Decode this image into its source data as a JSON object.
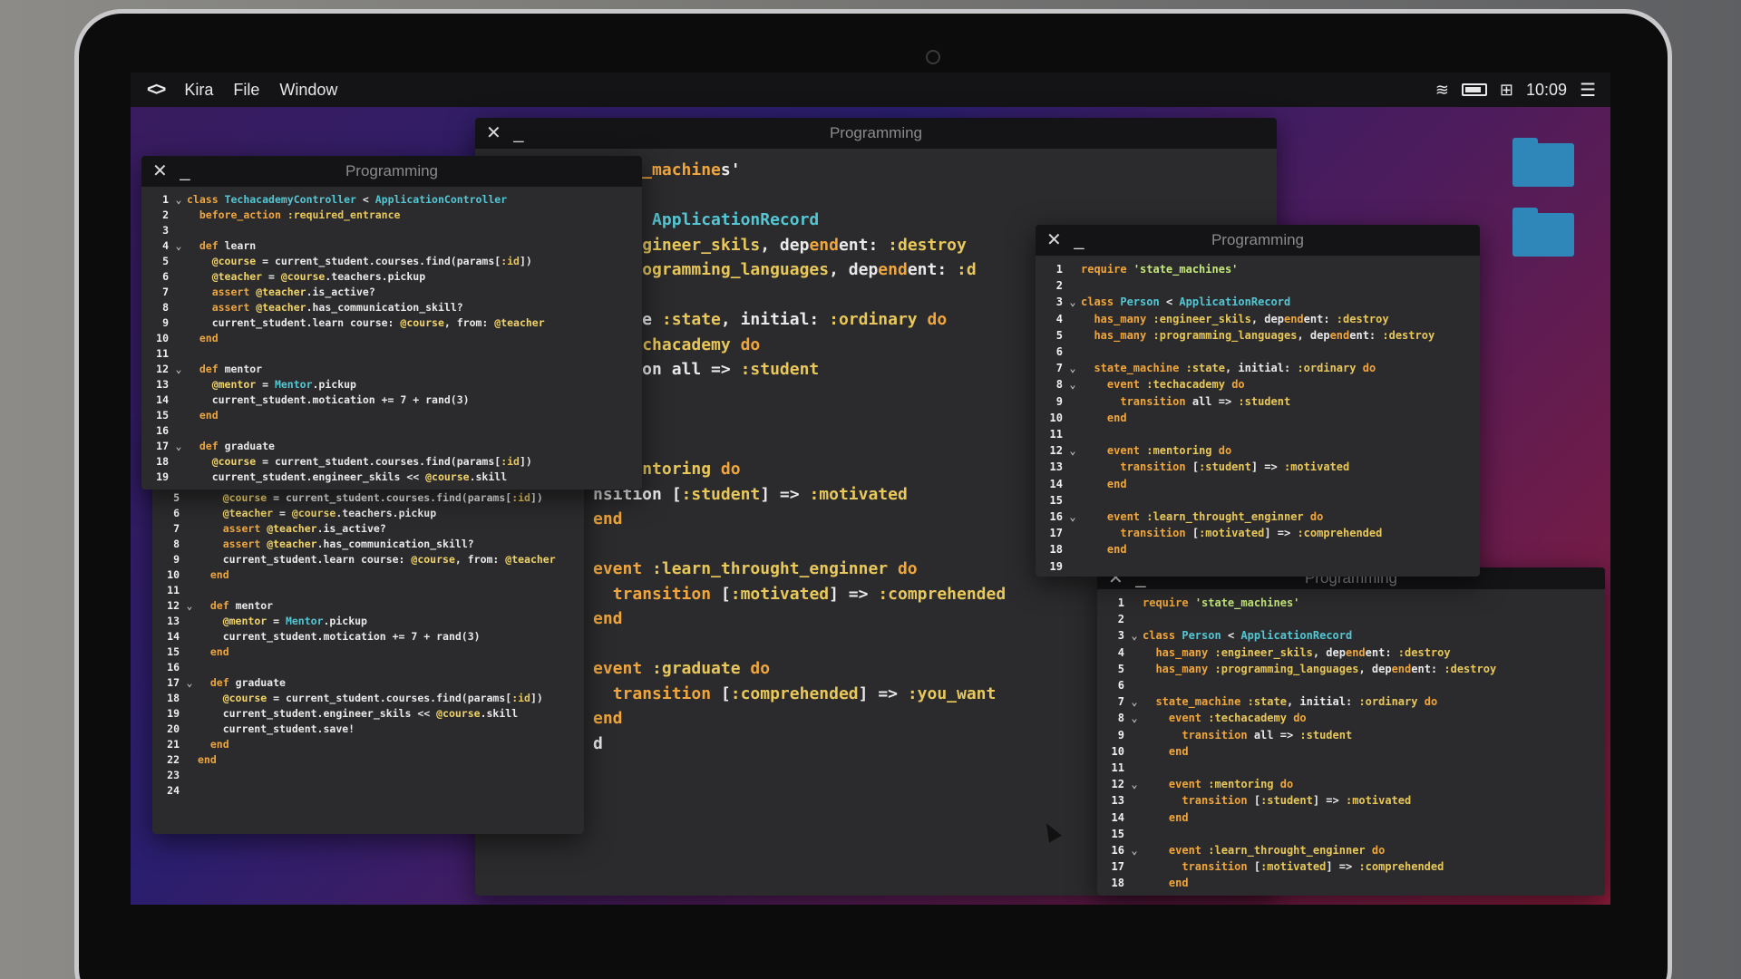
{
  "menubar": {
    "logo": "<>",
    "app": "Kira",
    "file": "File",
    "window": "Window",
    "time": "10:09"
  },
  "window_title": "Programming",
  "controls": "✕ _",
  "big_window_lines": [
    "state_machines'",
    "",
    "son < ApplicationRecord",
    "y :engineer_skils, dependent: :destroy",
    "y :programming_languages, dependent: :d",
    "",
    "achine :state, initial: :ordinary do",
    "  :techacademy do",
    "nsition all => :student",
    "",
    "",
    "",
    "  :mentoring do",
    "nsition [:student] => :motivated",
    "end",
    "",
    "event :learn_throught_enginner do",
    "  transition [:motivated] => :comprehended",
    "end",
    "",
    "event :graduate do",
    "  transition [:comprehended] => :you_want",
    "end",
    "d"
  ],
  "controller_code": [
    {
      "n": "1",
      "fold": "v",
      "t": "class TechacademyController < ApplicationController"
    },
    {
      "n": "2",
      "fold": "",
      "t": "  before_action :required_entrance"
    },
    {
      "n": "3",
      "fold": "",
      "t": ""
    },
    {
      "n": "4",
      "fold": "v",
      "t": "  def learn"
    },
    {
      "n": "5",
      "fold": "",
      "t": "    @course = current_student.courses.find(params[:id])"
    },
    {
      "n": "6",
      "fold": "",
      "t": "    @teacher = @course.teachers.pickup"
    },
    {
      "n": "7",
      "fold": "",
      "t": "    assert @teacher.is_active?"
    },
    {
      "n": "8",
      "fold": "",
      "t": "    assert @teacher.has_communication_skill?"
    },
    {
      "n": "9",
      "fold": "",
      "t": "    current_student.learn course: @course, from: @teacher"
    },
    {
      "n": "10",
      "fold": "",
      "t": "  end"
    },
    {
      "n": "11",
      "fold": "",
      "t": ""
    },
    {
      "n": "12",
      "fold": "v",
      "t": "  def mentor"
    },
    {
      "n": "13",
      "fold": "",
      "t": "    @mentor = Mentor.pickup"
    },
    {
      "n": "14",
      "fold": "",
      "t": "    current_student.motication += 7 + rand(3)"
    },
    {
      "n": "15",
      "fold": "",
      "t": "  end"
    },
    {
      "n": "16",
      "fold": "",
      "t": ""
    },
    {
      "n": "17",
      "fold": "v",
      "t": "  def graduate"
    },
    {
      "n": "18",
      "fold": "",
      "t": "    @course = current_student.courses.find(params[:id])"
    },
    {
      "n": "19",
      "fold": "",
      "t": "    current_student.engineer_skils << @course.skill"
    }
  ],
  "controller_code_back": [
    {
      "n": "2",
      "fold": "",
      "t": "  before_action :required_entrance"
    },
    {
      "n": "3",
      "fold": "",
      "t": ""
    },
    {
      "n": "4",
      "fold": "v",
      "t": "  def learn"
    },
    {
      "n": "5",
      "fold": "",
      "t": "    @course = current_student.courses.find(params[:id])"
    },
    {
      "n": "6",
      "fold": "",
      "t": "    @teacher = @course.teachers.pickup"
    },
    {
      "n": "7",
      "fold": "",
      "t": "    assert @teacher.is_active?"
    },
    {
      "n": "8",
      "fold": "",
      "t": "    assert @teacher.has_communication_skill?"
    },
    {
      "n": "9",
      "fold": "",
      "t": "    current_student.learn course: @course, from: @teacher"
    },
    {
      "n": "10",
      "fold": "",
      "t": "  end"
    },
    {
      "n": "11",
      "fold": "",
      "t": ""
    },
    {
      "n": "12",
      "fold": "v",
      "t": "  def mentor"
    },
    {
      "n": "13",
      "fold": "",
      "t": "    @mentor = Mentor.pickup"
    },
    {
      "n": "14",
      "fold": "",
      "t": "    current_student.motication += 7 + rand(3)"
    },
    {
      "n": "15",
      "fold": "",
      "t": "  end"
    },
    {
      "n": "16",
      "fold": "",
      "t": ""
    },
    {
      "n": "17",
      "fold": "v",
      "t": "  def graduate"
    },
    {
      "n": "18",
      "fold": "",
      "t": "    @course = current_student.courses.find(params[:id])"
    },
    {
      "n": "19",
      "fold": "",
      "t": "    current_student.engineer_skils << @course.skill"
    },
    {
      "n": "20",
      "fold": "",
      "t": "    current_student.save!"
    },
    {
      "n": "21",
      "fold": "",
      "t": "  end"
    },
    {
      "n": "22",
      "fold": "",
      "t": "end"
    },
    {
      "n": "23",
      "fold": "",
      "t": ""
    },
    {
      "n": "24",
      "fold": "",
      "t": ""
    }
  ],
  "person_code": [
    {
      "n": "1",
      "fold": "",
      "t": "require 'state_machines'"
    },
    {
      "n": "2",
      "fold": "",
      "t": ""
    },
    {
      "n": "3",
      "fold": "v",
      "t": "class Person < ApplicationRecord"
    },
    {
      "n": "4",
      "fold": "",
      "t": "  has_many :engineer_skils, dependent: :destroy"
    },
    {
      "n": "5",
      "fold": "",
      "t": "  has_many :programming_languages, dependent: :destroy"
    },
    {
      "n": "6",
      "fold": "",
      "t": ""
    },
    {
      "n": "7",
      "fold": "v",
      "t": "  state_machine :state, initial: :ordinary do"
    },
    {
      "n": "8",
      "fold": "v",
      "t": "    event :techacademy do"
    },
    {
      "n": "9",
      "fold": "",
      "t": "      transition all => :student"
    },
    {
      "n": "10",
      "fold": "",
      "t": "    end"
    },
    {
      "n": "11",
      "fold": "",
      "t": ""
    },
    {
      "n": "12",
      "fold": "v",
      "t": "    event :mentoring do"
    },
    {
      "n": "13",
      "fold": "",
      "t": "      transition [:student] => :motivated"
    },
    {
      "n": "14",
      "fold": "",
      "t": "    end"
    },
    {
      "n": "15",
      "fold": "",
      "t": ""
    },
    {
      "n": "16",
      "fold": "v",
      "t": "    event :learn_throught_enginner do"
    },
    {
      "n": "17",
      "fold": "",
      "t": "      transition [:motivated] => :comprehended"
    },
    {
      "n": "18",
      "fold": "",
      "t": "    end"
    },
    {
      "n": "19",
      "fold": "",
      "t": ""
    }
  ]
}
